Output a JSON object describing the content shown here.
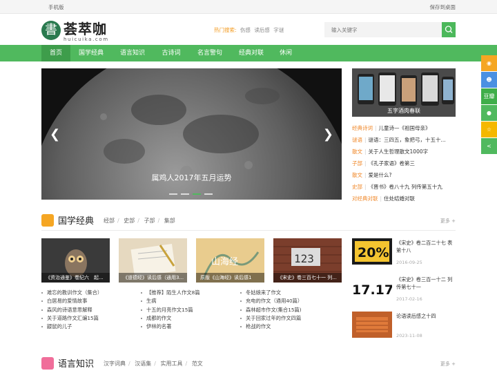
{
  "topbar": {
    "mobile": "手机版",
    "save_desktop": "保存到桌面"
  },
  "logo": {
    "mark": "書",
    "name": "荟萃咖",
    "domain": "huicuika.com"
  },
  "hot": {
    "label": "热门搜索:",
    "keywords": [
      "伤感",
      "读后感",
      "字谜"
    ]
  },
  "search": {
    "placeholder": "输入关键字"
  },
  "nav": {
    "items": [
      "首页",
      "国学经典",
      "语言知识",
      "古诗词",
      "名言警句",
      "经典对联",
      "休闲"
    ]
  },
  "banner": {
    "caption": "属鸡人2017年五月运势",
    "active_slide": 3,
    "slide_count": 4
  },
  "promo": {
    "caption": "五字酒肉春联"
  },
  "side_list": [
    {
      "cat": "经典诗词",
      "title": "儿童诗—《祖国母亲》"
    },
    {
      "cat": "谜语",
      "title": "谜语：三四五，象把弓，十五十..."
    },
    {
      "cat": "散文",
      "title": "关于人生哲理散文1000字"
    },
    {
      "cat": "子部",
      "title": "《孔子家语》卷第三"
    },
    {
      "cat": "散文",
      "title": "爱是什么?"
    },
    {
      "cat": "史部",
      "title": "《晋书》卷八十九 列传第五十九"
    },
    {
      "cat": "对经典对联",
      "title": "住处结婚对联"
    }
  ],
  "section1": {
    "title": "国学经典",
    "subs": [
      "经部",
      "史部",
      "子部",
      "集部"
    ],
    "more": "更多 +",
    "thumbs": [
      {
        "caption": "《资治通鉴》卷纪六　起..."
      },
      {
        "caption": "《道德经》读后感（通用3..."
      },
      {
        "caption": "原版《山海经》读后感1"
      },
      {
        "caption": "《宋史》卷三百七十一 列..."
      }
    ],
    "thumb_text": {
      "shanhai": "山海经",
      "num": "123"
    },
    "columns": [
      [
        "难忘的教训作文（集合）",
        "白居易的爱情故事",
        "森风的诗语意思解释",
        "关于道路作文汇编15篇",
        "鼹鼠的儿子"
      ],
      [
        "【推荐】陌生人作文8篇",
        "生病",
        "十五的月亮作文15篇",
        "成都的作文",
        "伊林的名著"
      ],
      [
        "冬姑娘来了作文",
        "充电的作文（通用40篇）",
        "森林超市作文(集合15篇)",
        "关于回家过年的作文四篇",
        "枪战的作文"
      ]
    ],
    "right_items": [
      {
        "img_text": "20%",
        "title": "《宋史》卷二百二十七 表第十八",
        "date": "2016-09-25"
      },
      {
        "img_text": "17.17",
        "title": "《宋史》卷三百一十二 列传第七十一",
        "date": "2017-02-16"
      },
      {
        "img_text": "",
        "title": "论语读后感之十四",
        "date": "2023-11-08"
      }
    ]
  },
  "section2": {
    "title": "语言知识",
    "subs": [
      "汉字词典",
      "汉语集",
      "实用工具",
      "范文"
    ],
    "more": "更多 +"
  },
  "share_labels": {
    "douban": "豆瓣"
  },
  "colors": {
    "green": "#50b95e",
    "orange": "#f0882a"
  }
}
